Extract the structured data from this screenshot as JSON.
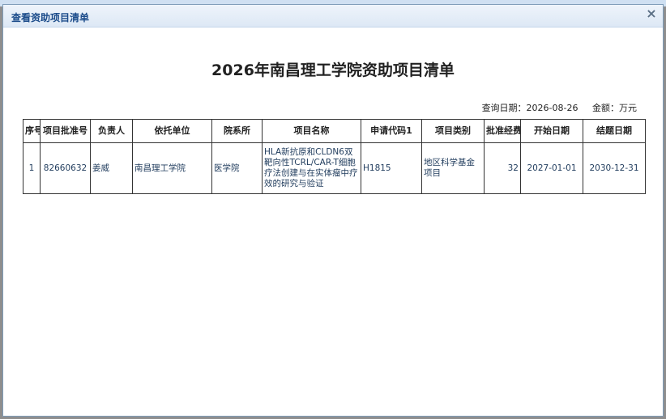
{
  "background": {
    "strip_items": [
      "…",
      "…",
      "…",
      "…"
    ]
  },
  "dialog": {
    "title": "查看资助项目清单",
    "close_label": "×"
  },
  "report": {
    "title": "2026年南昌理工学院资助项目清单",
    "query_date_label": "查询日期：2026-08-26",
    "amount_unit_label": "金额：万元"
  },
  "table": {
    "headers": [
      "序号",
      "项目批准号",
      "负责人",
      "依托单位",
      "院系所",
      "项目名称",
      "申请代码1",
      "项目类别",
      "批准经费",
      "开始日期",
      "结题日期"
    ],
    "rows": [
      [
        "1",
        "82660632",
        "姜威",
        "南昌理工学院",
        "医学院",
        "HLA新抗原和CLDN6双靶向性TCRL/CAR-T细胞疗法创建与在实体瘤中疗效的研究与验证",
        "H1815",
        "地区科学基金项目",
        "32",
        "2027-01-01",
        "2030-12-31"
      ]
    ]
  }
}
